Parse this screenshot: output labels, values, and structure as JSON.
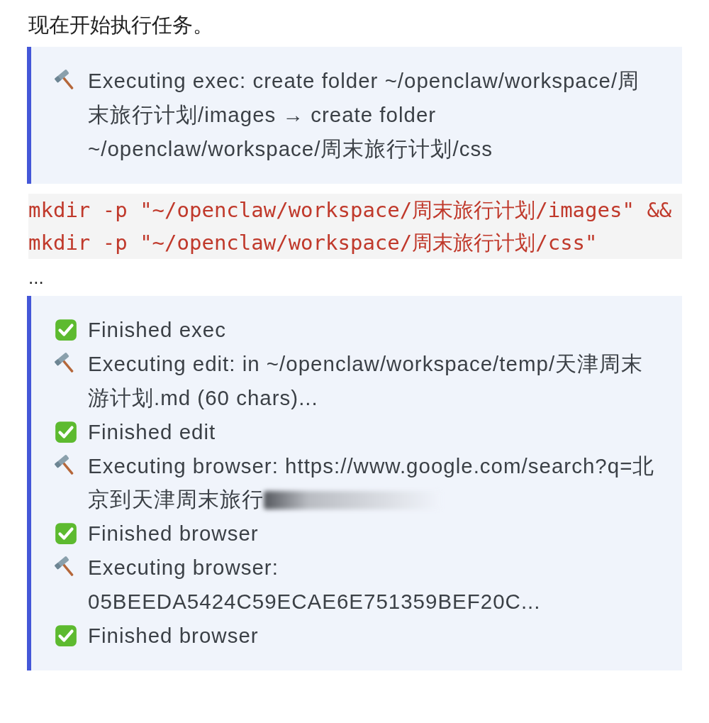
{
  "intro": "现在开始执行任务。",
  "blocks": [
    {
      "kind": "quote",
      "lines": [
        {
          "kind": "executing",
          "text": "Executing exec: create folder ~/openclaw/workspace/周末旅行计划/images → create folder ~/openclaw/workspace/周末旅行计划/css"
        }
      ]
    },
    {
      "kind": "code",
      "text": "mkdir -p \"~/openclaw/workspace/周末旅行计划/images\" && mkdir -p \"~/openclaw/workspace/周末旅行计划/css\""
    },
    {
      "kind": "text",
      "text": "..."
    },
    {
      "kind": "quote",
      "lines": [
        {
          "kind": "finished",
          "text": "Finished exec"
        },
        {
          "kind": "executing",
          "text": "Executing edit: in ~/openclaw/workspace/temp/天津周末游计划.md (60 chars)..."
        },
        {
          "kind": "finished",
          "text": "Finished edit"
        },
        {
          "kind": "executing",
          "text": "Executing browser: https://www.google.com/search?q=北京到天津周末旅行",
          "redacted": true
        },
        {
          "kind": "finished",
          "text": "Finished browser"
        },
        {
          "kind": "executing",
          "text": "Executing browser: 05BEEDA5424C59ECAE6E751359BEF20C..."
        },
        {
          "kind": "finished",
          "text": "Finished browser"
        }
      ]
    }
  ]
}
